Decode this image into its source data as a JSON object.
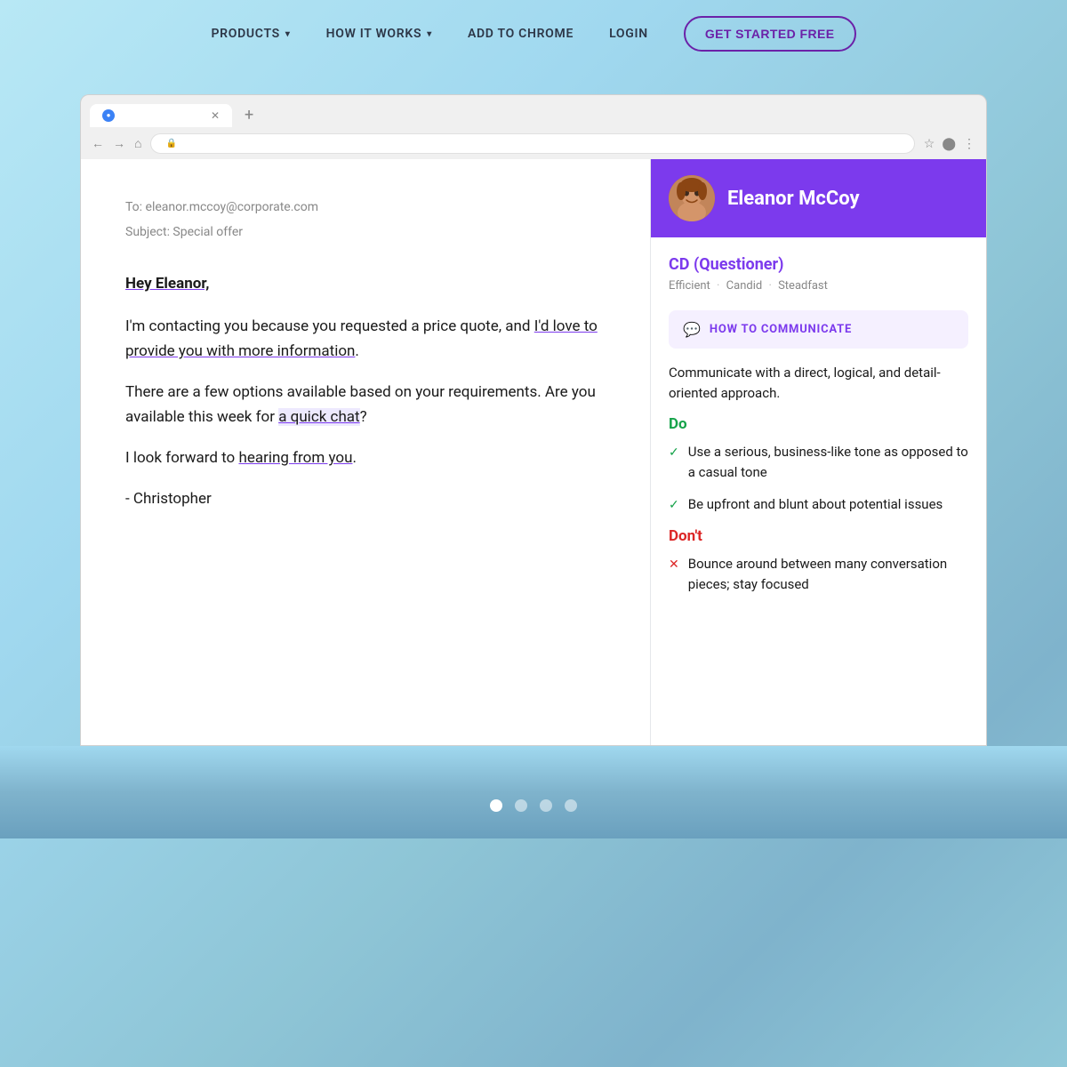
{
  "nav": {
    "products_label": "PRODUCTS",
    "how_it_works_label": "HOW IT WORKS",
    "add_to_chrome_label": "ADD TO CHROME",
    "login_label": "LOGIN",
    "cta_label": "GET STARTED FREE"
  },
  "browser": {
    "tab_title": "",
    "url": ""
  },
  "email": {
    "to": "To: eleanor.mccoy@corporate.com",
    "subject": "Subject: Special offer",
    "greeting": "Hey Eleanor,",
    "para1_pre": "I'm contacting you because you requested a price quote, and ",
    "para1_link": "I'd love to provide you with more information",
    "para1_post": ".",
    "para2_pre": "There are a few options available based on your requirements.  Are you available this week for ",
    "para2_link": "a quick chat",
    "para2_post": "?",
    "para3_pre": "I look forward to ",
    "para3_link": "hearing from you",
    "para3_post": ".",
    "sig": "- Christopher"
  },
  "profile": {
    "name": "Eleanor McCoy",
    "type": "CD (Questioner)",
    "trait1": "Efficient",
    "trait2": "Candid",
    "trait3": "Steadfast",
    "how_to_label": "HOW TO COMMUNICATE",
    "description": "Communicate with a direct, logical, and detail-oriented approach.",
    "do_label": "Do",
    "do_items": [
      "Use a serious, business-like tone as opposed to a casual tone",
      "Be upfront and blunt about potential issues"
    ],
    "dont_label": "Don't",
    "dont_items": [
      "Bounce around between many conversation pieces; stay focused"
    ]
  },
  "pagination": {
    "dots": [
      {
        "active": true
      },
      {
        "active": false
      },
      {
        "active": false
      },
      {
        "active": false
      }
    ]
  }
}
